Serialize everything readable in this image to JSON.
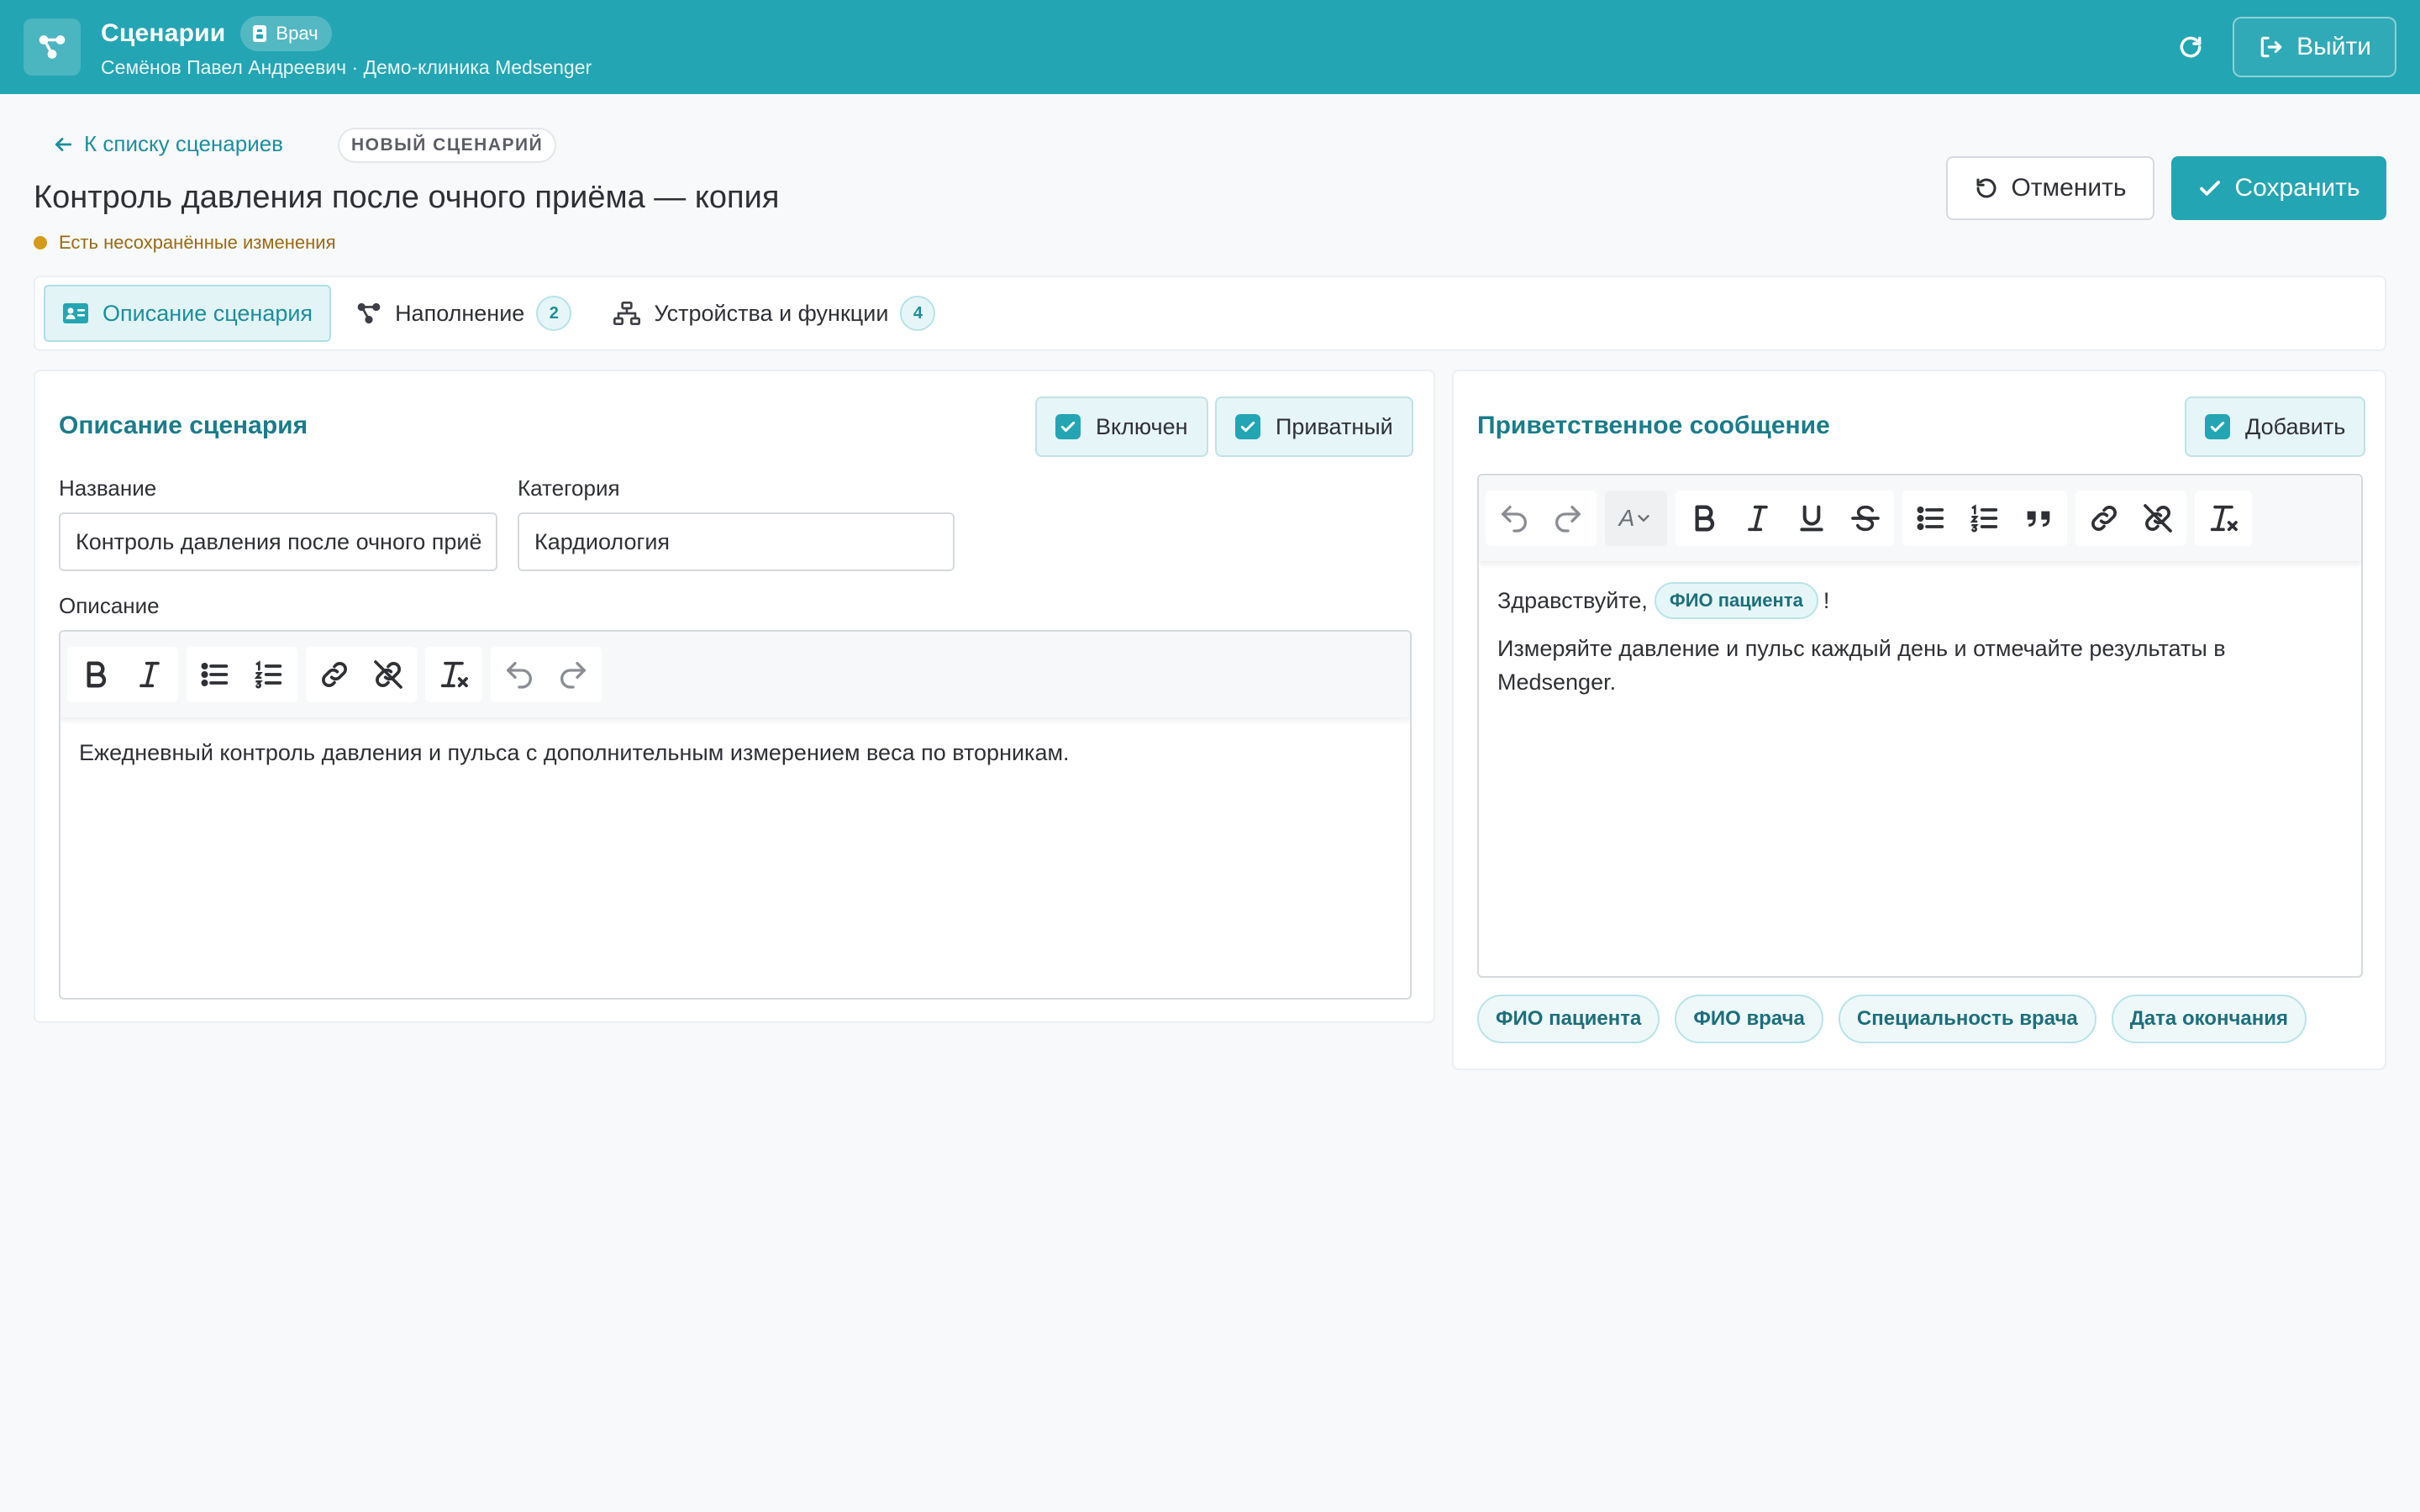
{
  "app": {
    "title": "Сценарии",
    "role_badge": "Врач",
    "subtitle": "Семёнов Павел Андреевич · Демо-клиника Medsenger",
    "logout_label": "Выйти"
  },
  "header": {
    "back_link": "К списку сценариев",
    "status_badge": "НОВЫЙ СЦЕНАРИЙ",
    "title": "Контроль давления после очного приёма — копия",
    "unsaved_text": "Есть несохранённые изменения",
    "cancel_label": "Отменить",
    "save_label": "Сохранить"
  },
  "tabs": [
    {
      "label": "Описание сценария",
      "active": true
    },
    {
      "label": "Наполнение",
      "count": "2"
    },
    {
      "label": "Устройства и функции",
      "count": "4"
    }
  ],
  "description_card": {
    "title": "Описание сценария",
    "enabled_label": "Включен",
    "enabled_checked": true,
    "private_label": "Приватный",
    "private_checked": true,
    "name_label": "Название",
    "name_value": "Контроль давления после очного приёма — копия",
    "category_label": "Категория",
    "category_value": "Кардиология",
    "description_label": "Описание",
    "description_text": "Ежедневный контроль давления и пульса с дополнительным измерением веса по вторникам."
  },
  "greeting_card": {
    "title": "Приветственное сообщение",
    "add_label": "Добавить",
    "add_checked": true,
    "font_select_value": "A",
    "line1_prefix": "Здравствуйте,",
    "line1_chip": "ФИО пациента",
    "line1_suffix": "!",
    "line2": "Измеряйте давление и пульс каждый день и отмечайте результаты в Medsenger.",
    "variable_chips": [
      "ФИО пациента",
      "ФИО врача",
      "Специальность врача",
      "Дата окончания"
    ]
  },
  "colors": {
    "accent": "#24a5b3",
    "accent_dark": "#1a7c89",
    "warning_dot": "#d49b1b"
  }
}
